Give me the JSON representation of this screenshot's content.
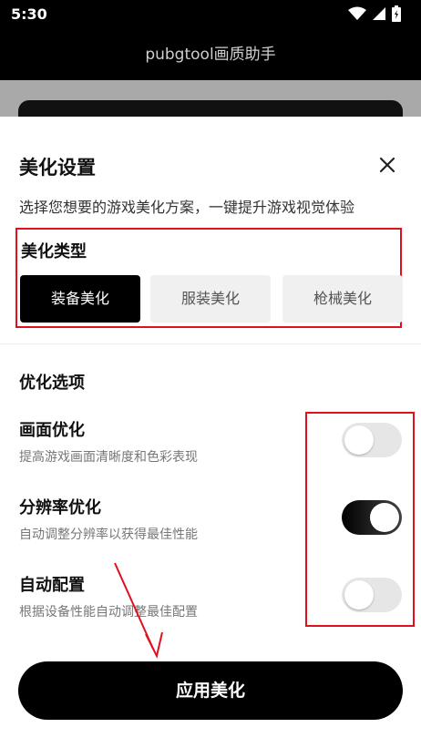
{
  "status_bar": {
    "time": "5:30",
    "icons": [
      "wifi-icon",
      "signal-icon",
      "battery-icon"
    ]
  },
  "app_bar": {
    "title": "pubgtool画质助手"
  },
  "sheet": {
    "title": "美化设置",
    "subtitle": "选择您想要的游戏美化方案，一键提升游戏视觉体验",
    "close_icon": "close-icon",
    "beautify_type": {
      "heading": "美化类型",
      "options": [
        {
          "label": "装备美化",
          "selected": true
        },
        {
          "label": "服装美化",
          "selected": false
        },
        {
          "label": "枪械美化",
          "selected": false
        }
      ]
    },
    "optimization": {
      "heading": "优化选项",
      "options": [
        {
          "title": "画面优化",
          "desc": "提高游戏画面清晰度和色彩表现",
          "enabled": false
        },
        {
          "title": "分辨率优化",
          "desc": "自动调整分辨率以获得最佳性能",
          "enabled": true
        },
        {
          "title": "自动配置",
          "desc": "根据设备性能自动调整最佳配置",
          "enabled": false
        }
      ]
    },
    "apply_button": "应用美化"
  },
  "colors": {
    "accent": "#000000",
    "annotation_red": "#e0101e",
    "toggle_off": "#e6e6e6"
  }
}
